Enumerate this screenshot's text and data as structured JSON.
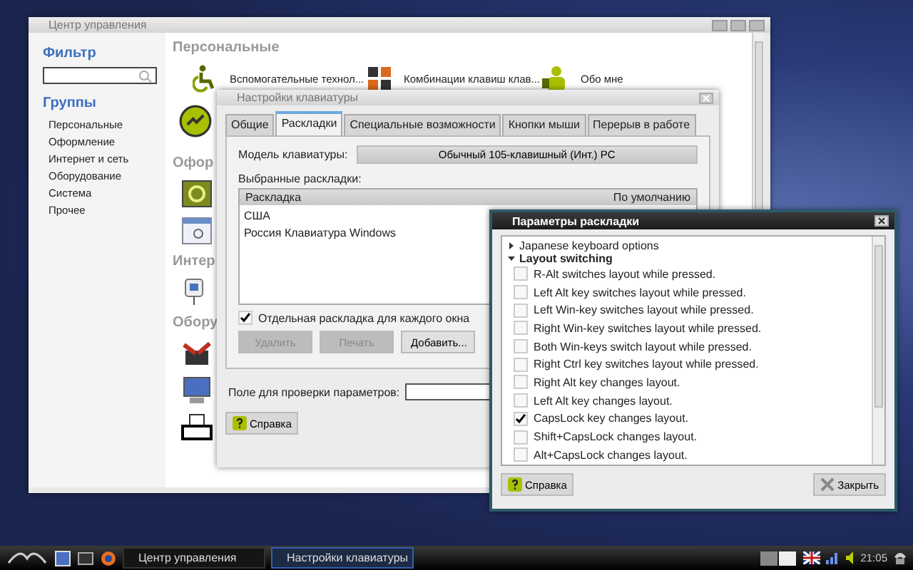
{
  "control_center": {
    "title": "Центр управления",
    "filter_label": "Фильтр",
    "groups_label": "Группы",
    "groups": [
      {
        "label": "Персональные"
      },
      {
        "label": "Оформление"
      },
      {
        "label": "Интернет и сеть"
      },
      {
        "label": "Оборудование"
      },
      {
        "label": "Система"
      },
      {
        "label": "Прочее"
      }
    ],
    "sections": [
      {
        "heading": "Персональные",
        "items": [
          {
            "label": "Вспомогательные технол..."
          },
          {
            "label": "Комбинации клавиш клав..."
          },
          {
            "label": "Обо мне"
          }
        ]
      },
      {
        "heading": "Офор"
      },
      {
        "heading": "Интер"
      },
      {
        "heading": "Обору"
      }
    ]
  },
  "keyboard_window": {
    "title": "Настройки клавиатуры",
    "tabs": [
      {
        "label": "Общие",
        "selected": false
      },
      {
        "label": "Раскладки",
        "selected": true
      },
      {
        "label": "Специальные возможности",
        "selected": false
      },
      {
        "label": "Кнопки мыши",
        "selected": false
      },
      {
        "label": "Перерыв в работе",
        "selected": false
      }
    ],
    "model_label": "Модель клавиатуры:",
    "model_value": "Обычный 105-клавишный (Инт.) PC",
    "layouts_label": "Выбранные раскладки:",
    "table": {
      "columns": [
        "Раскладка",
        "По умолчанию"
      ],
      "rows": [
        [
          "США"
        ],
        [
          "Россия Клавиатура Windows"
        ]
      ]
    },
    "separate_layout": {
      "label": "Отдельная раскладка для каждого окна",
      "checked": true
    },
    "buttons": [
      {
        "label": "Удалить",
        "disabled": true
      },
      {
        "label": "Печать",
        "disabled": true
      },
      {
        "label": "Добавить...",
        "disabled": false
      }
    ],
    "test_field_label": "Поле для проверки параметров:",
    "help_button": "Справка"
  },
  "layout_options": {
    "title": "Параметры раскладки",
    "items": [
      {
        "label": "Japanese keyboard options",
        "expanded": false
      },
      {
        "label": "Layout switching",
        "expanded": true,
        "children": [
          {
            "label": "R-Alt switches layout while pressed.",
            "checked": false
          },
          {
            "label": "Left Alt key switches layout while pressed.",
            "checked": false
          },
          {
            "label": "Left Win-key switches layout while pressed.",
            "checked": false
          },
          {
            "label": "Right Win-key switches layout while pressed.",
            "checked": false
          },
          {
            "label": "Both Win-keys switch layout while pressed.",
            "checked": false
          },
          {
            "label": "Right Ctrl key switches layout while pressed.",
            "checked": false
          },
          {
            "label": "Right Alt key changes layout.",
            "checked": false
          },
          {
            "label": "Left Alt key changes layout.",
            "checked": false
          },
          {
            "label": "CapsLock key changes layout.",
            "checked": true
          },
          {
            "label": "Shift+CapsLock changes layout.",
            "checked": false
          },
          {
            "label": "Alt+CapsLock changes layout.",
            "checked": false
          }
        ]
      }
    ],
    "help_button": "Справка",
    "close_button": "Закрыть"
  },
  "taskbar": {
    "tasks": [
      {
        "label": "Центр управления",
        "selected": false
      },
      {
        "label": "Настройки клавиатуры",
        "selected": true
      }
    ],
    "clock": "21:05"
  }
}
